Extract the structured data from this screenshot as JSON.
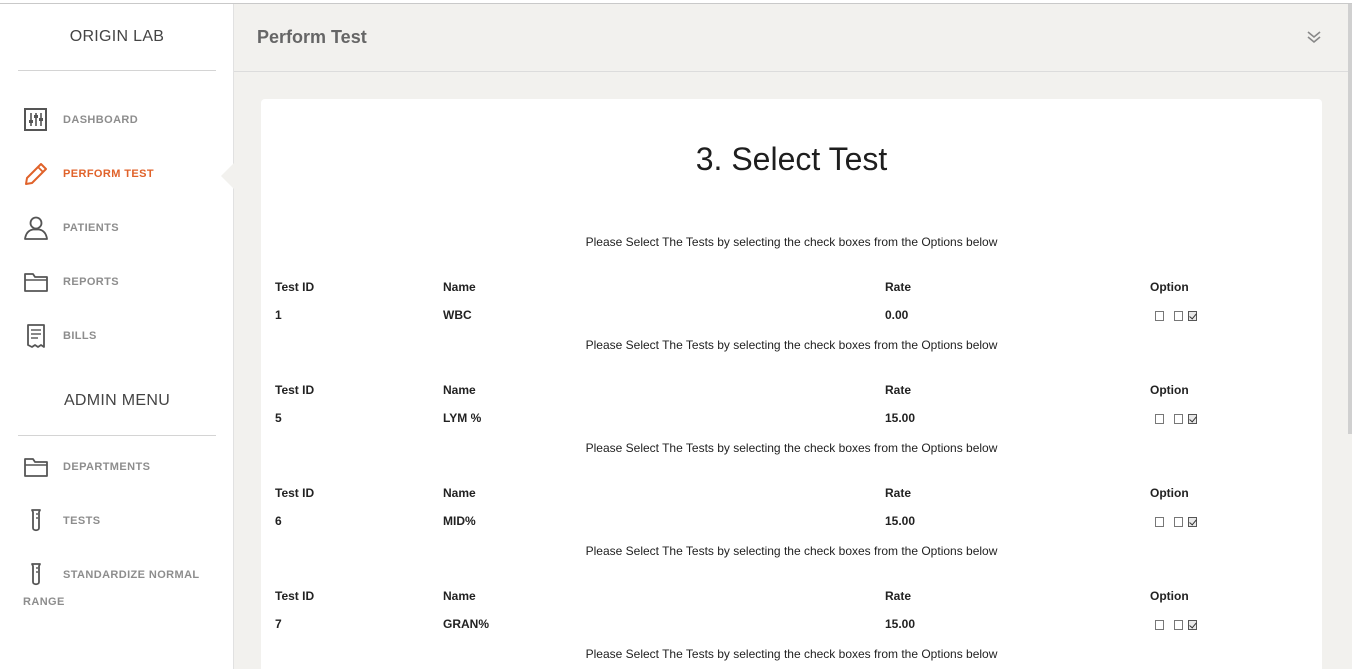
{
  "sidebar": {
    "brand": "ORIGIN LAB",
    "items": [
      {
        "label": "DASHBOARD",
        "icon": "sliders-icon"
      },
      {
        "label": "PERFORM TEST",
        "icon": "pen-icon",
        "active": true
      },
      {
        "label": "PATIENTS",
        "icon": "user-icon"
      },
      {
        "label": "REPORTS",
        "icon": "folder-icon"
      },
      {
        "label": "BILLS",
        "icon": "receipt-icon"
      }
    ],
    "admin_heading": "ADMIN MENU",
    "admin_items": [
      {
        "label": "DEPARTMENTS",
        "icon": "folder-icon"
      },
      {
        "label": "TESTS",
        "icon": "test-tube-icon"
      },
      {
        "label": "STANDARDIZE NORMAL",
        "label_cont": "RANGE",
        "icon": "test-tube-icon"
      }
    ]
  },
  "header": {
    "title": "Perform Test",
    "collapse_icon": "double-chevron-down-icon"
  },
  "main": {
    "title": "3. Select Test",
    "instruction": "Please Select The Tests by selecting the check boxes from the Options below",
    "columns": {
      "id": "Test ID",
      "name": "Name",
      "rate": "Rate",
      "option": "Option"
    },
    "tests": [
      {
        "id": "1",
        "name": "WBC",
        "rate": "0.00",
        "options": [
          false,
          false,
          true
        ]
      },
      {
        "id": "5",
        "name": "LYM %",
        "rate": "15.00",
        "options": [
          false,
          false,
          true
        ]
      },
      {
        "id": "6",
        "name": "MID%",
        "rate": "15.00",
        "options": [
          false,
          false,
          true
        ]
      },
      {
        "id": "7",
        "name": "GRAN%",
        "rate": "15.00",
        "options": [
          false,
          false,
          true
        ]
      }
    ]
  },
  "colors": {
    "accent": "#e0622a",
    "nav_text": "#8d8d8d",
    "page_bg": "#f2f1ee"
  }
}
